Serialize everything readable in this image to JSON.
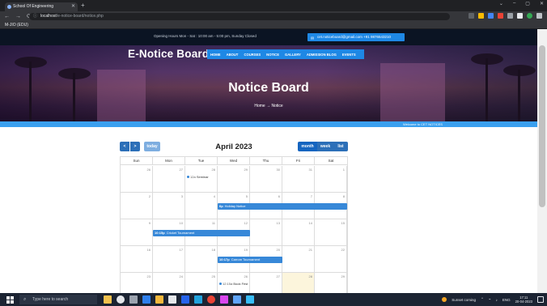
{
  "browser": {
    "tab_title": "School Of Engineering",
    "url_host": "localhost",
    "url_path": "/e-notice-board/notice.php",
    "bookmark": "M-JIO (EDU)"
  },
  "topbar": {
    "hours": "Opening Hours Mon - Sat : 10:00 am - 5:00 pm, Sunday Closed",
    "contact": "cet.noticeboard@gmail.com  +91 9876543210"
  },
  "site": {
    "brand": "E-Notice Board",
    "menu": [
      "HOME",
      "ABOUT",
      "COURSES",
      "NOTICE",
      "GALLERY",
      "ADMISSION BLOG",
      "EVENTS"
    ],
    "hero_title": "Notice Board",
    "breadcrumb_home": "Home",
    "breadcrumb_arrow": "→",
    "breadcrumb_current": "Notice",
    "ticker": "Welcome to CET NOTICES"
  },
  "calendar": {
    "title": "April 2023",
    "prev": "<",
    "next": ">",
    "today_label": "today",
    "view_month": "month",
    "view_week": "week",
    "view_list": "list",
    "days_of_week": [
      "Sun",
      "Mon",
      "Tue",
      "Wed",
      "Thu",
      "Fri",
      "Sat"
    ],
    "weeks": [
      [
        "26",
        "27",
        "28",
        "29",
        "30",
        "31",
        "1"
      ],
      [
        "2",
        "3",
        "4",
        "5",
        "6",
        "7",
        "8"
      ],
      [
        "9",
        "10",
        "11",
        "12",
        "13",
        "14",
        "15"
      ],
      [
        "16",
        "17",
        "18",
        "19",
        "20",
        "21",
        "22"
      ],
      [
        "23",
        "24",
        "25",
        "26",
        "27",
        "28",
        "29"
      ]
    ],
    "events": [
      {
        "time": "12a",
        "title": "Seminar",
        "style": "dot"
      },
      {
        "time": "6p",
        "title": "Holiday Notice",
        "style": "bar"
      },
      {
        "time": "10:15p",
        "title": "Cricket Tournament",
        "style": "bar"
      },
      {
        "time": "10:17p",
        "title": "Carrom Tournament",
        "style": "bar"
      },
      {
        "time": "12:15a",
        "title": "Book Fest",
        "style": "dot"
      }
    ]
  },
  "taskbar": {
    "search_placeholder": "Type here to search",
    "weather": "Sunset coming",
    "lang": "ENG",
    "time": "17:11",
    "date": "20-04-2023"
  },
  "colors": {
    "accent": "#1e88e5",
    "event": "#3788d8",
    "today_highlight": "#fcf5dc"
  }
}
